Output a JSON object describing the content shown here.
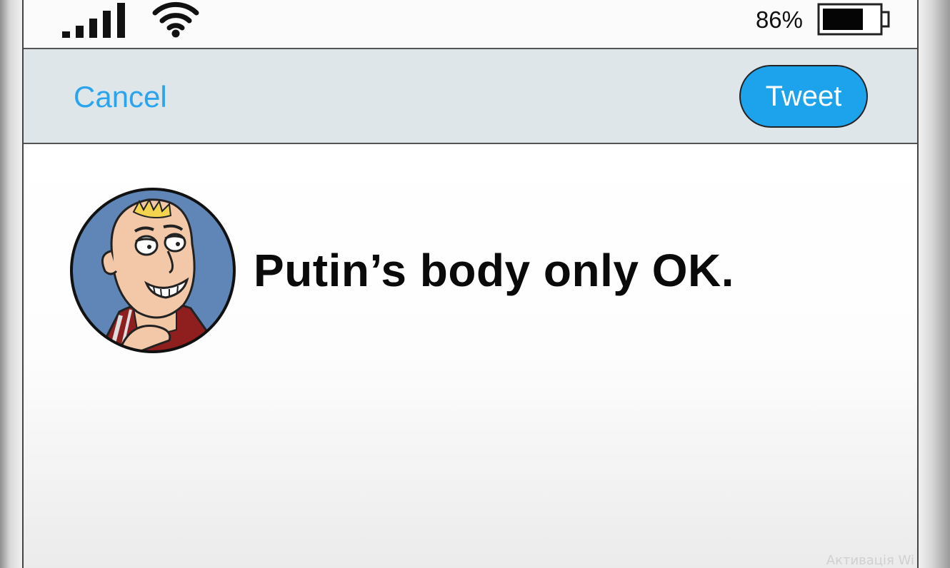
{
  "status_bar": {
    "battery_percent": "86%",
    "battery_level": 0.86,
    "signal_bars": 5,
    "icons": [
      "cellular-signal-icon",
      "wifi-icon",
      "battery-icon"
    ]
  },
  "nav_bar": {
    "cancel_label": "Cancel",
    "tweet_label": "Tweet"
  },
  "compose": {
    "tweet_text": "Putin’s body only OK."
  },
  "watermark": {
    "text": "Активація Wi"
  },
  "colors": {
    "accent": "#1da3ec",
    "cancel_text": "#2aa4ee",
    "nav_background": "#dfe6ea"
  }
}
